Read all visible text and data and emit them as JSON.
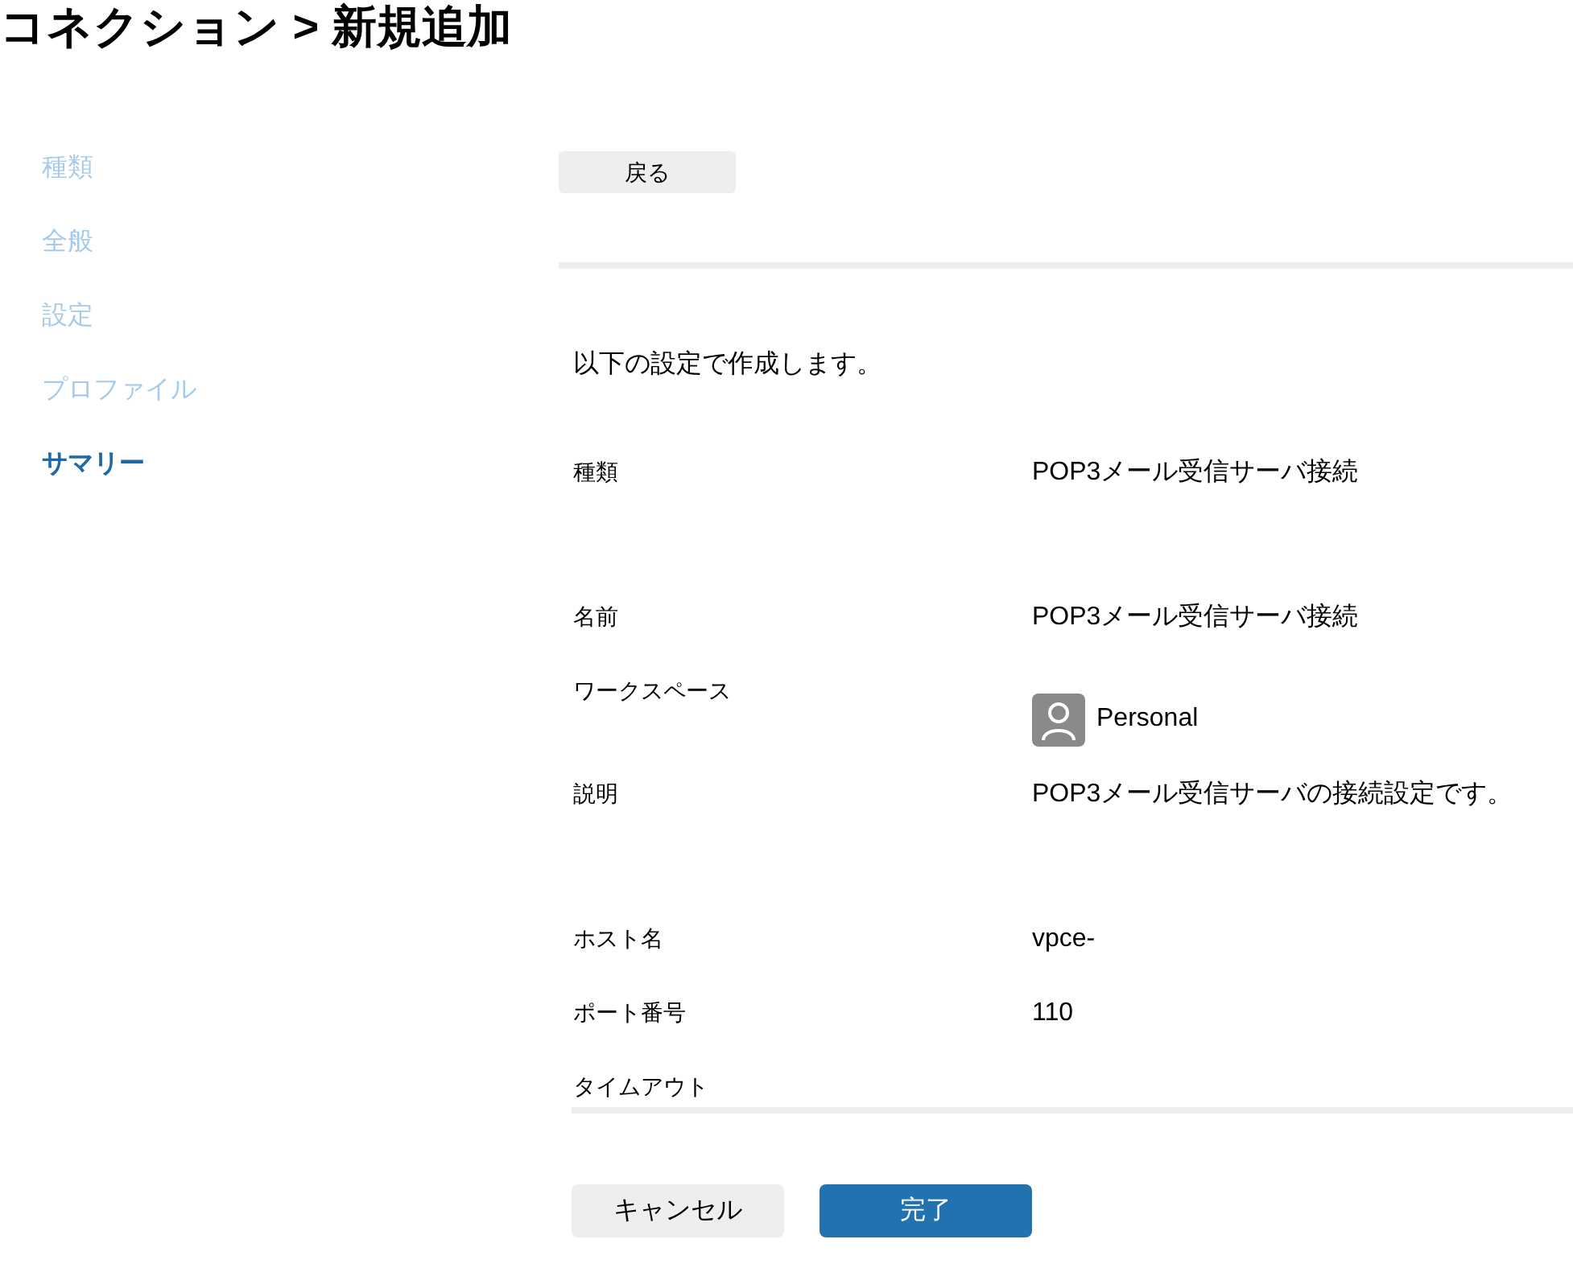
{
  "title": "コネクション > 新規追加",
  "steps": [
    {
      "label": "種類",
      "selected": false
    },
    {
      "label": "全般",
      "selected": false
    },
    {
      "label": "設定",
      "selected": false
    },
    {
      "label": "プロファイル",
      "selected": false
    },
    {
      "label": "サマリー",
      "selected": true
    }
  ],
  "back_button": "戻る",
  "intro": "以下の設定で作成します。",
  "groups": [
    {
      "rows": [
        {
          "label": "種類",
          "kind": "text",
          "value": "POP3メール受信サーバ接続"
        }
      ]
    },
    {
      "rows": [
        {
          "label": "名前",
          "kind": "text",
          "value": "POP3メール受信サーバ接続"
        },
        {
          "label": "ワークスペース",
          "kind": "workspace",
          "value": "Personal"
        },
        {
          "label": "説明",
          "kind": "text",
          "value": "POP3メール受信サーバの接続設定です。"
        }
      ]
    },
    {
      "rows": [
        {
          "label": "ホスト名",
          "kind": "text",
          "value": "vpce-"
        },
        {
          "label": "ポート番号",
          "kind": "text",
          "value": "110"
        },
        {
          "label": "タイムアウト",
          "kind": "empty"
        }
      ]
    }
  ],
  "buttons": [
    {
      "label": "キャンセル",
      "kind": "secondary"
    },
    {
      "label": "完了",
      "kind": "primary"
    }
  ]
}
